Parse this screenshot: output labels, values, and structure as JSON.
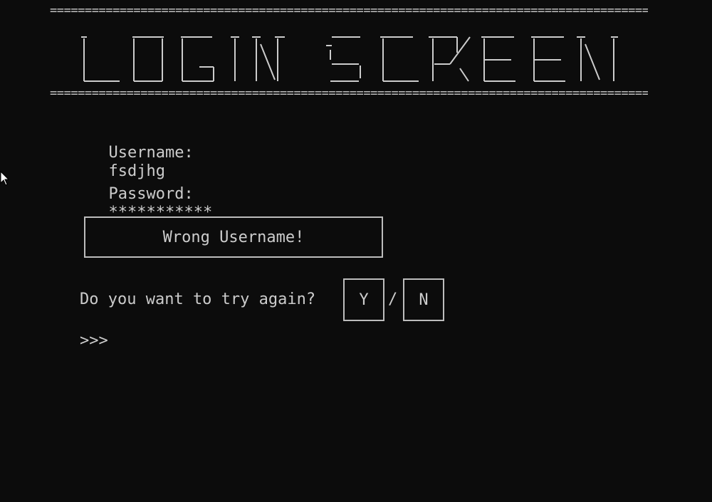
{
  "banner": {
    "rule": "======================================================================================",
    "title": "LOGIN SCREEN"
  },
  "form": {
    "username_label": "Username:",
    "username_value": "fsdjhg",
    "password_label": "Password:",
    "password_value": "***********"
  },
  "message": {
    "text": "Wrong Username!"
  },
  "retry": {
    "question": "Do you want to try again?",
    "yes": "Y",
    "separator": "/",
    "no": "N"
  },
  "console": {
    "prompt": ">>>"
  }
}
